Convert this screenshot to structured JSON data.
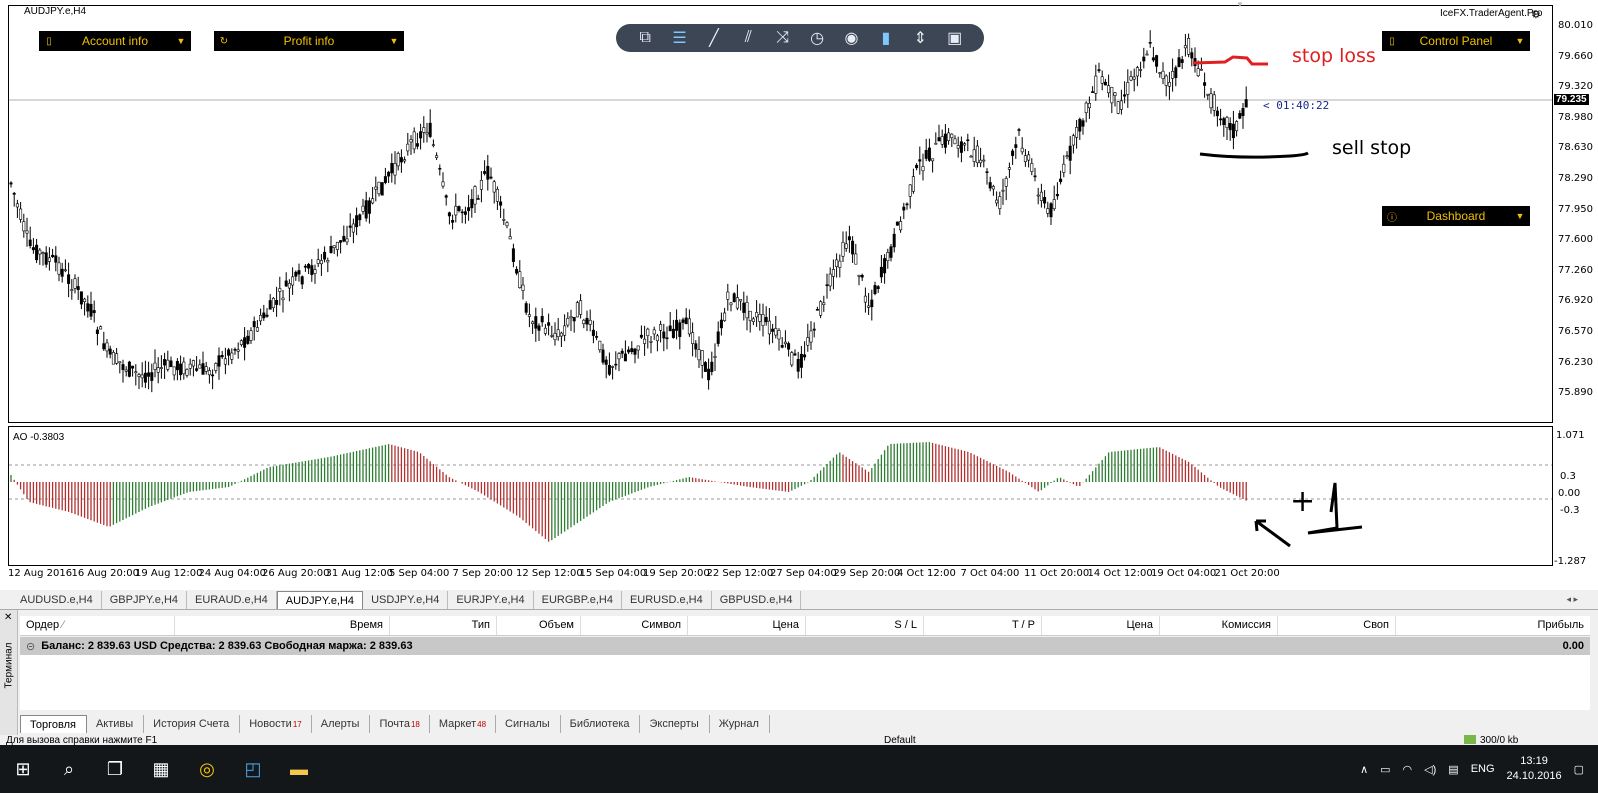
{
  "chart": {
    "title": "AUDJPY.e,H4",
    "brand": "IceFX.TraderAgent.Pro",
    "current_price": "79.235",
    "countdown": "< 01:40:22",
    "price_levels": [
      "80.010",
      "79.660",
      "79.320",
      "78.980",
      "78.630",
      "78.290",
      "77.950",
      "77.600",
      "77.260",
      "76.920",
      "76.570",
      "76.230",
      "75.890"
    ],
    "dates": [
      "12 Aug 2016",
      "16 Aug 20:00",
      "19 Aug 12:00",
      "24 Aug 04:00",
      "26 Aug 20:00",
      "31 Aug 12:00",
      "5 Sep 04:00",
      "7 Sep 20:00",
      "12 Sep 12:00",
      "15 Sep 04:00",
      "19 Sep 20:00",
      "22 Sep 12:00",
      "27 Sep 04:00",
      "29 Sep 20:00",
      "4 Oct 12:00",
      "7 Oct 04:00",
      "11 Oct 20:00",
      "14 Oct 12:00",
      "19 Oct 04:00",
      "21 Oct 20:00"
    ],
    "colors": {
      "bull": "#2e7d32",
      "bear": "#b03030",
      "stoploss": "#e02020",
      "ink": "#000000",
      "toolbar": "#3c4654",
      "panel_text": "#f0c000"
    }
  },
  "indicator": {
    "title": "AO -0.3803",
    "levels": [
      "1.071",
      "0.3",
      "0.00",
      "-0.3",
      "-1.287"
    ]
  },
  "panels": {
    "account_info": "Account info",
    "profit_info": "Profit info",
    "control_panel": "Control Panel",
    "dashboard": "Dashboard"
  },
  "toolbar": {
    "icons": [
      "windows-icon",
      "lines-menu-icon",
      "trendline-icon",
      "channel-icon",
      "shuffle-icon",
      "clock-icon",
      "eye-icon",
      "bucket-icon",
      "split-icon",
      "camera-icon"
    ]
  },
  "annotations": {
    "stop_loss": "stop loss",
    "sell_stop": "sell stop",
    "plus_sign": "+"
  },
  "symbol_tabs": [
    "AUDUSD.e,H4",
    "GBPJPY.e,H4",
    "EURAUD.e,H4",
    "AUDJPY.e,H4",
    "USDJPY.e,H4",
    "EURJPY.e,H4",
    "EURGBP.e,H4",
    "EURUSD.e,H4",
    "GBPUSD.e,H4"
  ],
  "terminal": {
    "side_label": "Терминал",
    "columns": [
      "Ордер",
      "Время",
      "Тип",
      "Объем",
      "Символ",
      "Цена",
      "S / L",
      "T / P",
      "Цена",
      "Комиссия",
      "Своп",
      "Прибыль"
    ],
    "balance_text": "Баланс: 2 839.63 USD  Средства: 2 839.63  Свободная маржа: 2 839.63",
    "profit_total": "0.00",
    "tabs": [
      {
        "label": "Торговля",
        "badge": ""
      },
      {
        "label": "Активы",
        "badge": ""
      },
      {
        "label": "История Счета",
        "badge": ""
      },
      {
        "label": "Новости",
        "badge": "17"
      },
      {
        "label": "Алерты",
        "badge": ""
      },
      {
        "label": "Почта",
        "badge": "18"
      },
      {
        "label": "Маркет",
        "badge": "48"
      },
      {
        "label": "Сигналы",
        "badge": ""
      },
      {
        "label": "Библиотека",
        "badge": ""
      },
      {
        "label": "Эксперты",
        "badge": ""
      },
      {
        "label": "Журнал",
        "badge": ""
      }
    ]
  },
  "status": {
    "help": "Для вызова справки нажмите F1",
    "profile": "Default",
    "traffic": "300/0 kb"
  },
  "taskbar": {
    "lang": "ENG",
    "time": "13:19",
    "date": "24.10.2016"
  }
}
